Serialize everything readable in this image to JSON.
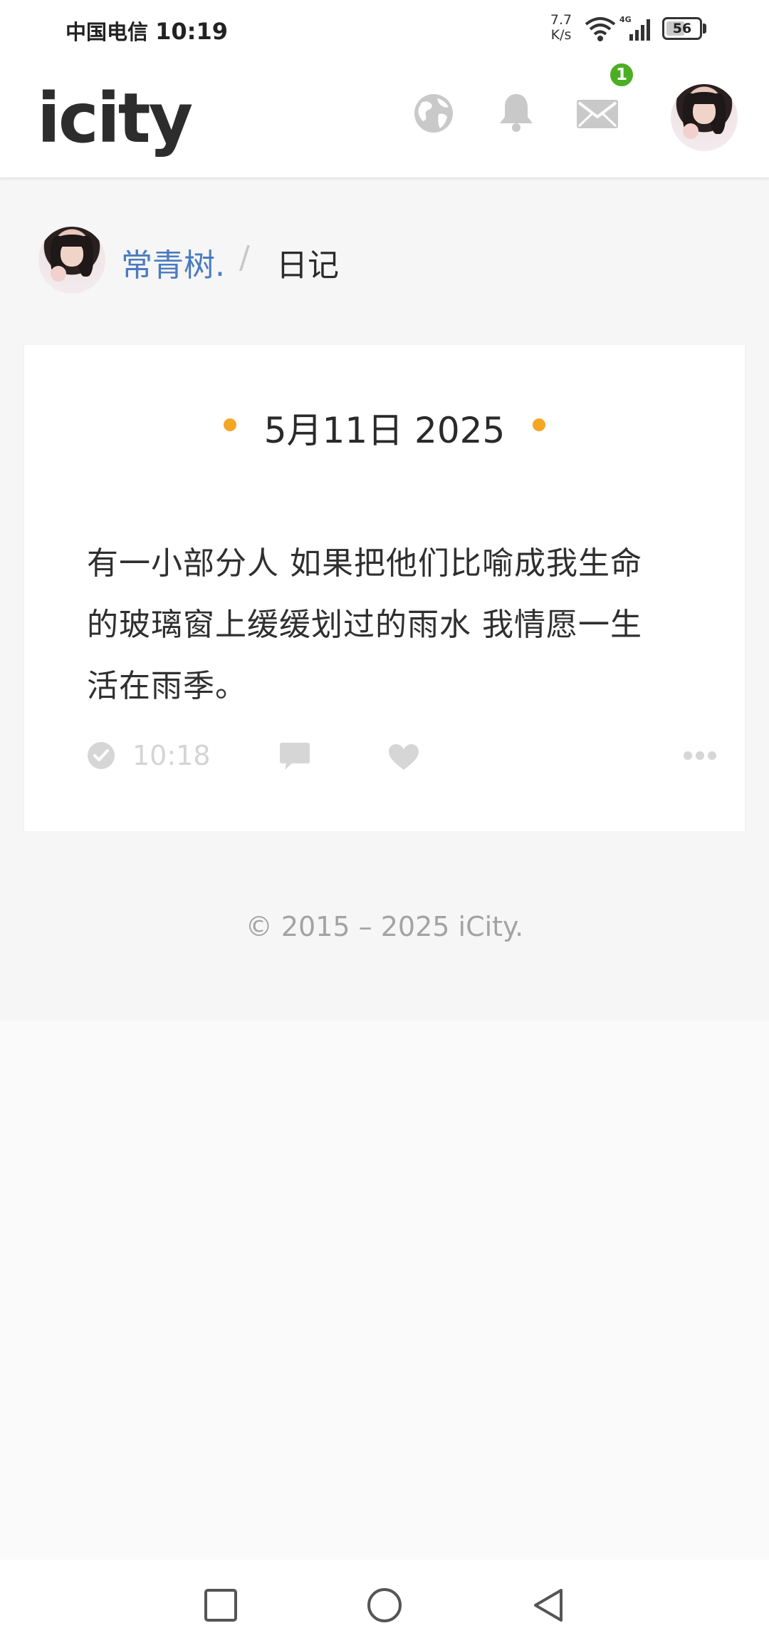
{
  "status_bar": {
    "carrier": "中国电信",
    "time": "10:19",
    "net_speed_value": "7.7",
    "net_speed_unit": "K/s",
    "network": "4G",
    "battery": "56",
    "battery_level": 0.56
  },
  "header": {
    "logo": "icity",
    "mail_badge": "1"
  },
  "breadcrumb": {
    "user": "常青树.",
    "separator": "/",
    "page": "日记"
  },
  "entry": {
    "date": "5月11日 2025",
    "text_lines": [
      "有一小部分人 如果把他们比喻成我生命",
      "的玻璃窗上缓缓划过的雨水 我情愿一生",
      "活在雨季。"
    ],
    "time": "10:18"
  },
  "footer": {
    "copyright": "© 2015 – 2025 iCity."
  },
  "colors": {
    "user_link": "#4a7bbf",
    "date_dot": "#f5a623",
    "badge": "#4caf23",
    "muted_icon": "#d6d6d6"
  },
  "icons": [
    "globe-icon",
    "bell-icon",
    "mail-icon",
    "clock-icon",
    "comment-icon",
    "heart-icon",
    "more-icon"
  ]
}
